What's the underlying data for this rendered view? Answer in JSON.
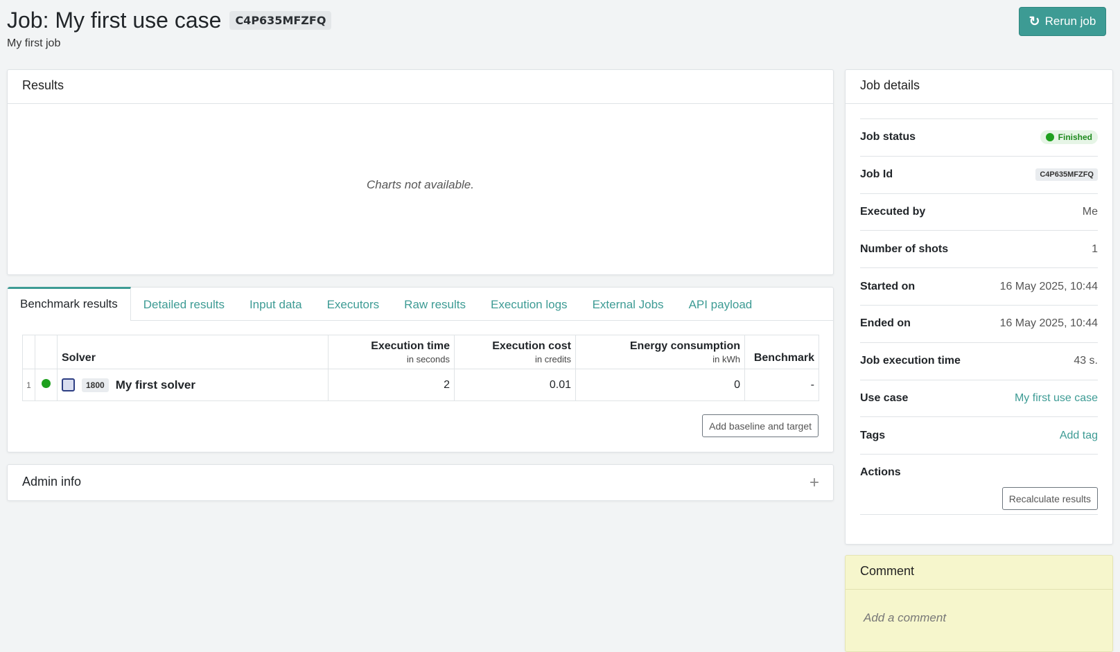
{
  "header": {
    "title": "Job: My first use case",
    "job_code": "C4P635MFZFQ",
    "subtitle": "My first job",
    "rerun_label": "Rerun job"
  },
  "results": {
    "title": "Results",
    "empty_message": "Charts not available."
  },
  "tabs": [
    {
      "label": "Benchmark results",
      "active": true
    },
    {
      "label": "Detailed results"
    },
    {
      "label": "Input data"
    },
    {
      "label": "Executors"
    },
    {
      "label": "Raw results"
    },
    {
      "label": "Execution logs"
    },
    {
      "label": "External Jobs"
    },
    {
      "label": "API payload"
    }
  ],
  "benchmark_table": {
    "columns": {
      "solver": "Solver",
      "exec_time": "Execution time",
      "exec_time_unit": "in seconds",
      "exec_cost": "Execution cost",
      "exec_cost_unit": "in credits",
      "energy": "Energy consumption",
      "energy_unit": "in kWh",
      "benchmark": "Benchmark"
    },
    "rows": [
      {
        "index": "1",
        "status_color": "#1ea01e",
        "solver_id": "1800",
        "solver_name": "My first solver",
        "exec_time": "2",
        "exec_cost": "0.01",
        "energy": "0",
        "benchmark": "-"
      }
    ],
    "add_baseline_label": "Add baseline and target"
  },
  "admin": {
    "title": "Admin info",
    "expand_icon": "plus-icon"
  },
  "job_details": {
    "title": "Job details",
    "status_label": "Job status",
    "status_value": "Finished",
    "id_label": "Job Id",
    "id_value": "C4P635MFZFQ",
    "executed_by_label": "Executed by",
    "executed_by_value": "Me",
    "shots_label": "Number of shots",
    "shots_value": "1",
    "started_label": "Started on",
    "started_value": "16 May 2025, 10:44",
    "ended_label": "Ended on",
    "ended_value": "16 May 2025, 10:44",
    "exec_time_label": "Job execution time",
    "exec_time_value": "43 s.",
    "use_case_label": "Use case",
    "use_case_value": "My first use case",
    "tags_label": "Tags",
    "tags_value": "Add tag",
    "actions_label": "Actions",
    "recalc_label": "Recalculate results"
  },
  "comment": {
    "title": "Comment",
    "placeholder": "Add a comment"
  },
  "colors": {
    "accent": "#3d9b94",
    "success": "#1ea01e",
    "comment_bg": "#f6f6cc"
  }
}
